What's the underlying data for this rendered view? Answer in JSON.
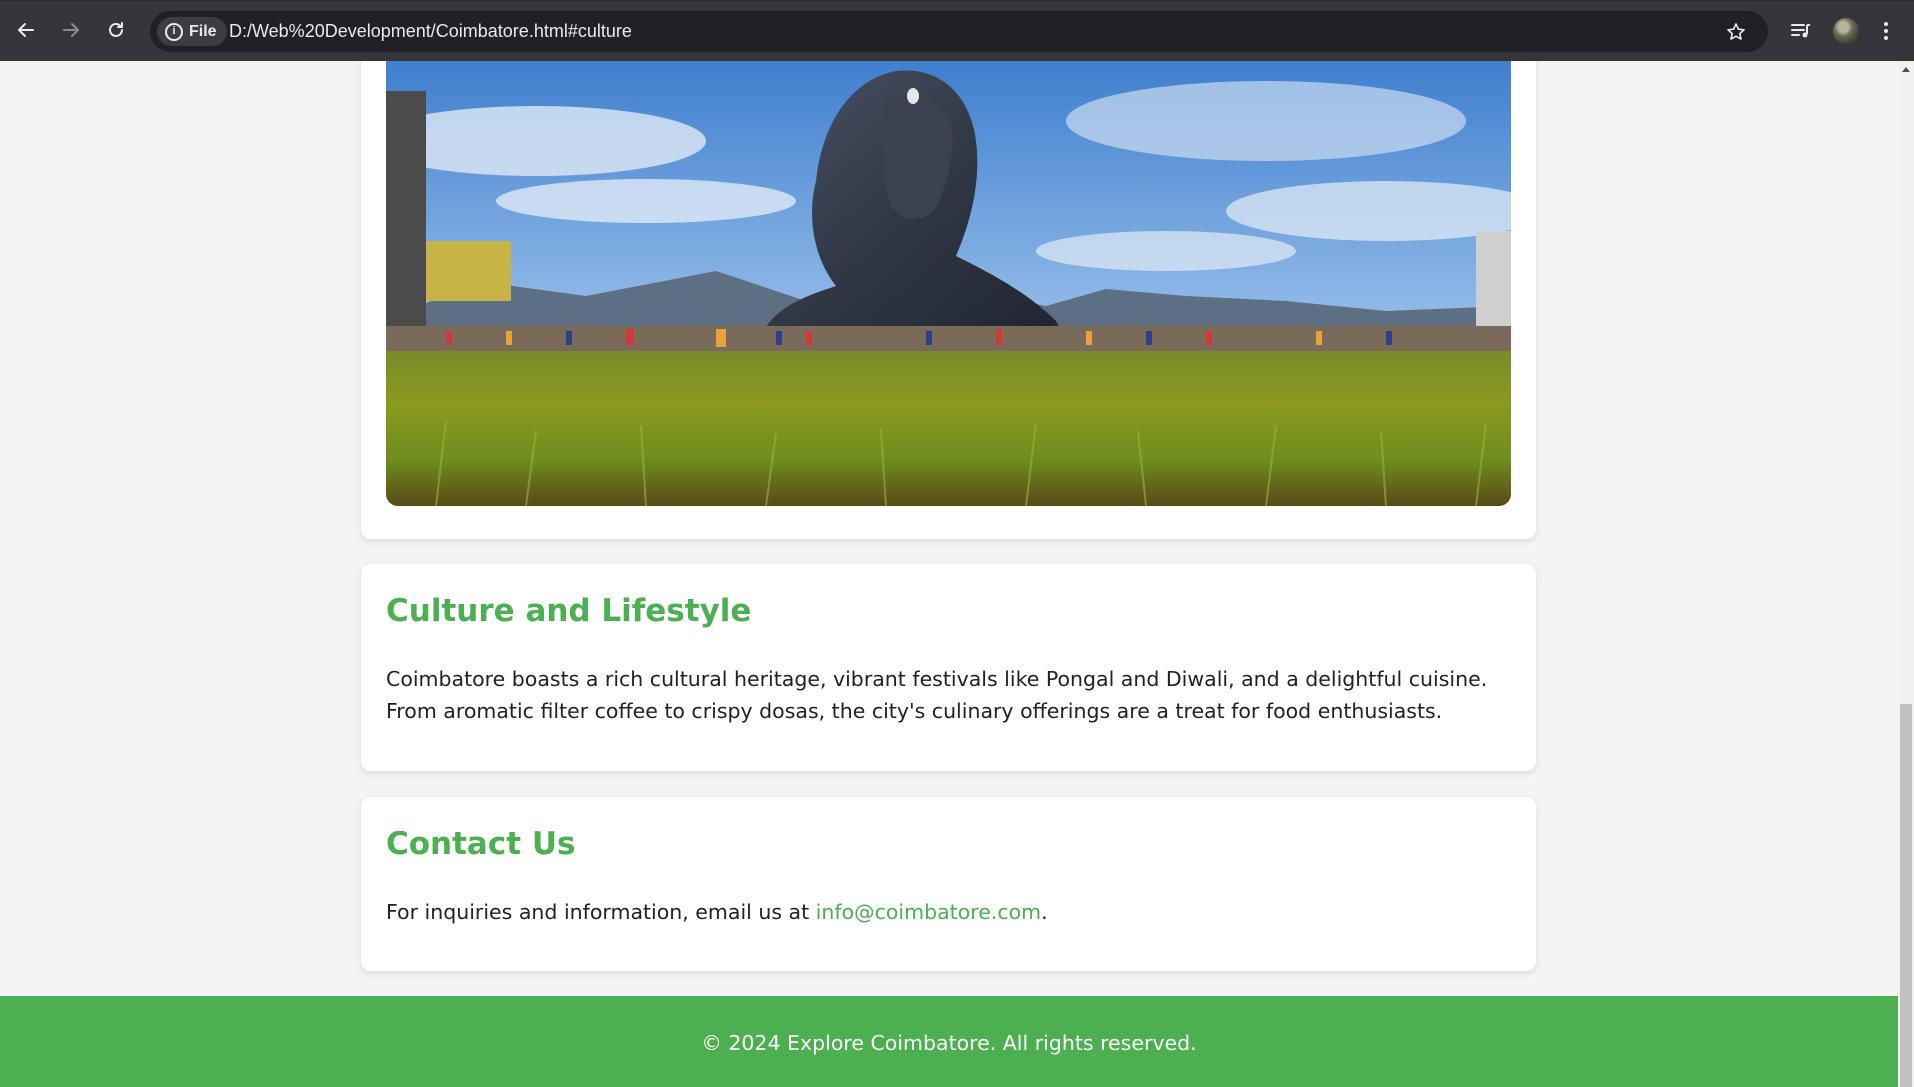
{
  "browser": {
    "chip_label": "File",
    "url": "D:/Web%20Development/Coimbatore.html#culture",
    "icons": [
      "back-arrow-icon",
      "forward-arrow-icon",
      "reload-icon",
      "info-icon",
      "star-icon",
      "media-control-icon",
      "profile-avatar",
      "more-menu-icon"
    ]
  },
  "hero_image": {
    "subject": "Adiyogi Shiva statue photograph"
  },
  "culture": {
    "heading": "Culture and Lifestyle",
    "body": "Coimbatore boasts a rich cultural heritage, vibrant festivals like Pongal and Diwali, and a delightful cuisine. From aromatic filter coffee to crispy dosas, the city's culinary offerings are a treat for food enthusiasts."
  },
  "contact": {
    "heading": "Contact Us",
    "text_before": "For inquiries and information, email us at ",
    "email": "info@coimbatore.com",
    "text_after": "."
  },
  "footer": {
    "text": "© 2024 Explore Coimbatore. All rights reserved."
  },
  "colors": {
    "accent": "#4caf50",
    "page_bg": "#f4f4f4",
    "card_bg": "#ffffff",
    "chrome_bg": "#35363a"
  }
}
